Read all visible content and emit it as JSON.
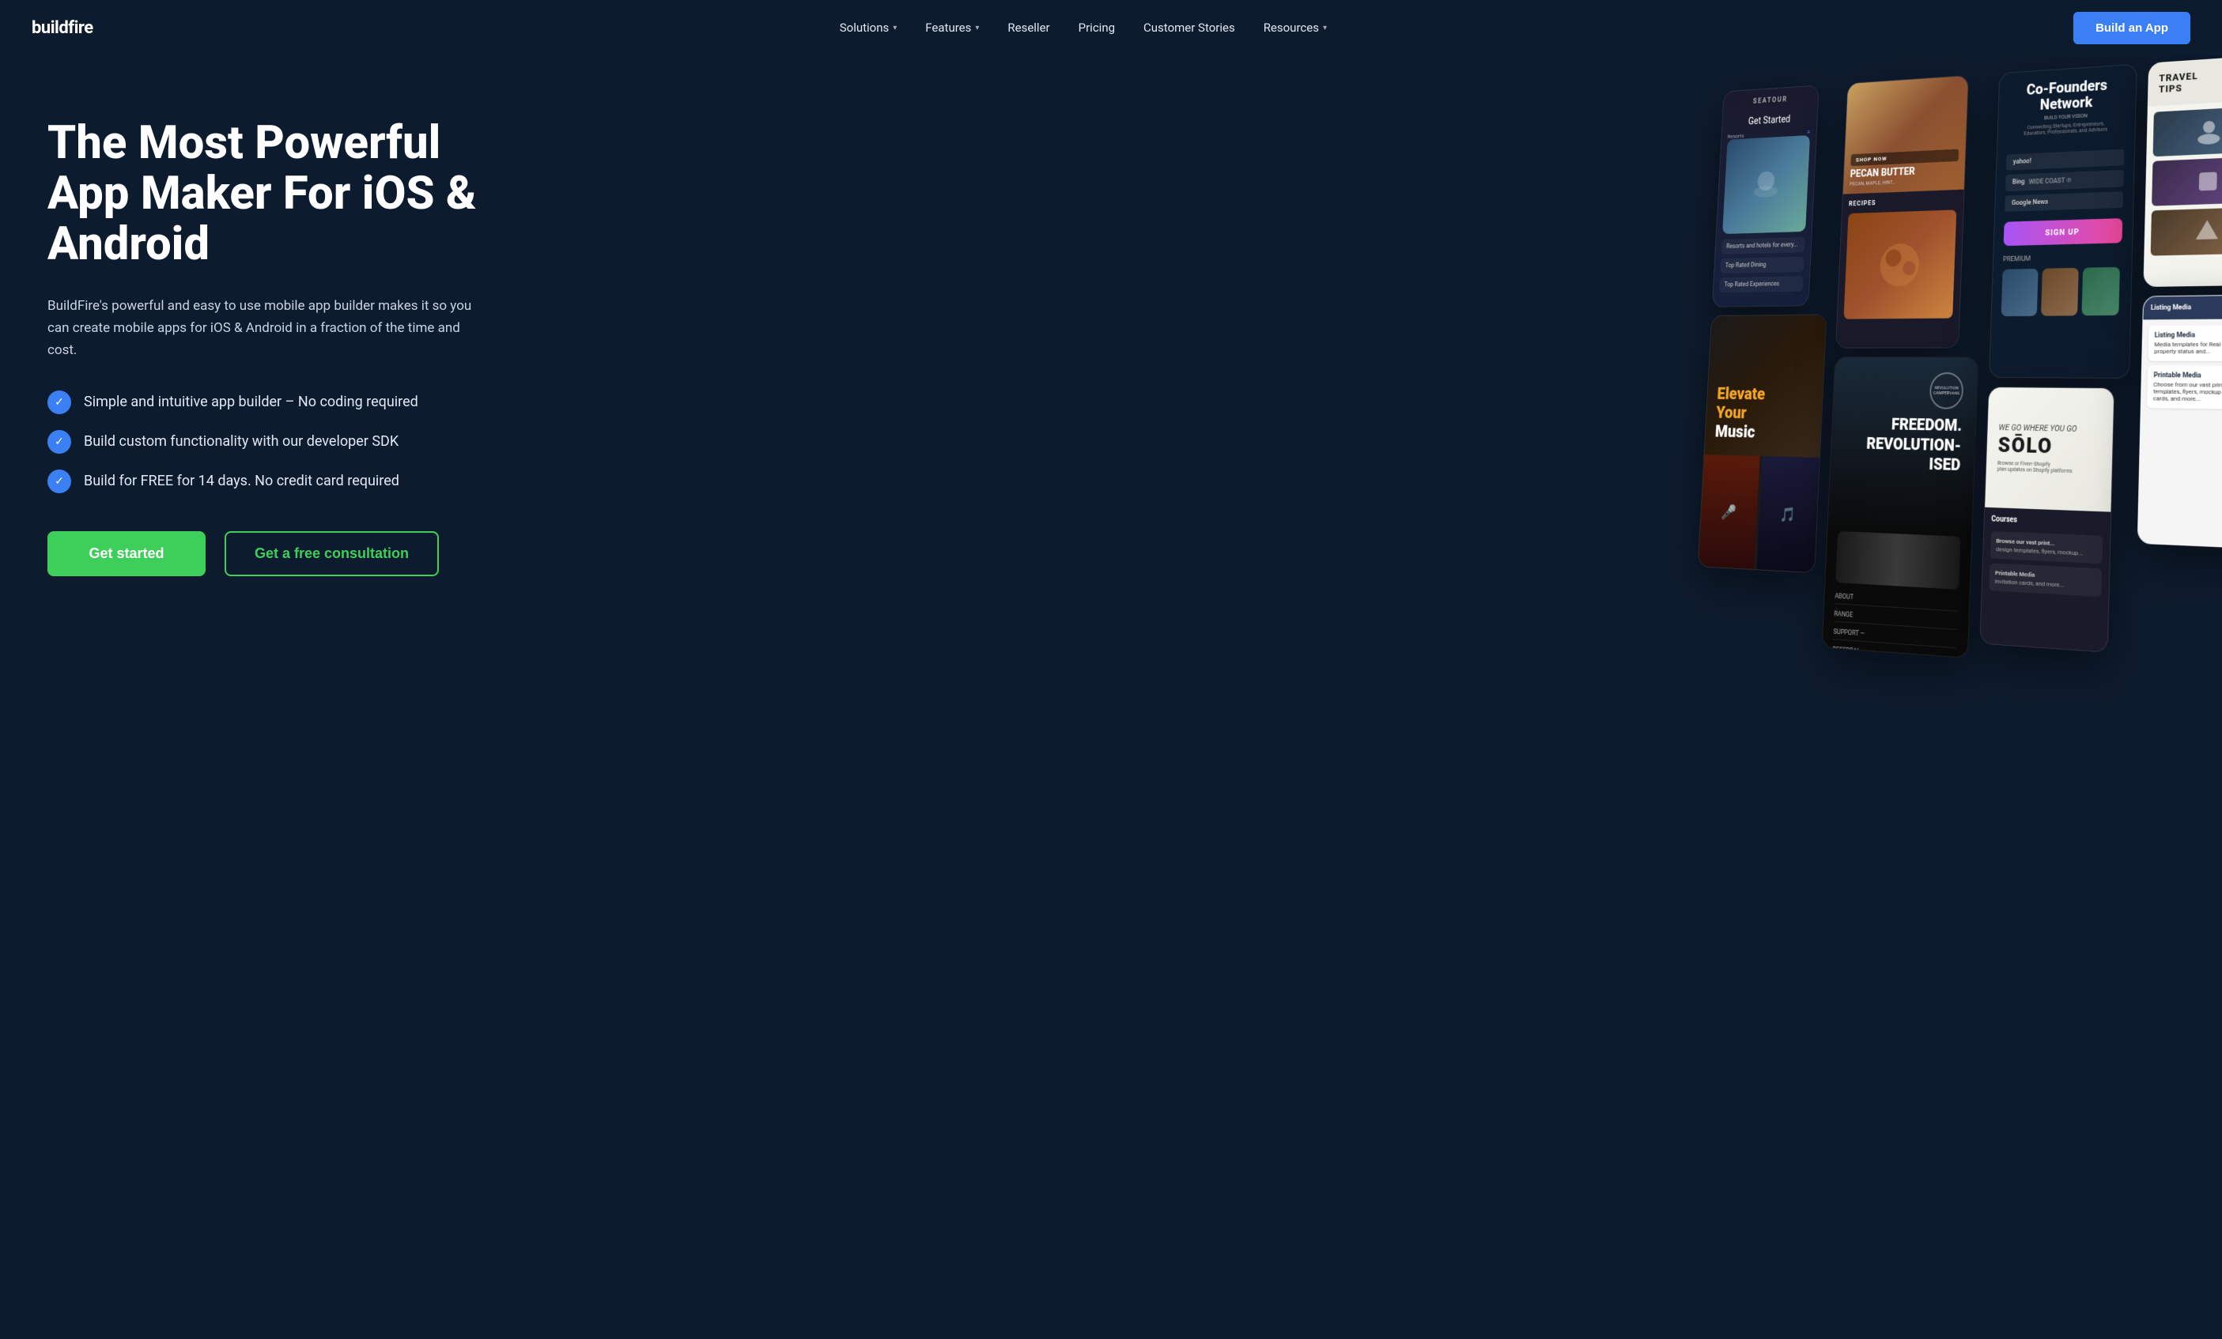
{
  "brand": {
    "name": "buildfire",
    "logo_text": "buildfire"
  },
  "navbar": {
    "links": [
      {
        "label": "Solutions",
        "hasDropdown": true
      },
      {
        "label": "Features",
        "hasDropdown": true
      },
      {
        "label": "Reseller",
        "hasDropdown": false
      },
      {
        "label": "Pricing",
        "hasDropdown": false
      },
      {
        "label": "Customer Stories",
        "hasDropdown": false
      },
      {
        "label": "Resources",
        "hasDropdown": true
      }
    ],
    "cta_label": "Build an App"
  },
  "hero": {
    "title": "The Most Powerful App Maker For iOS & Android",
    "subtitle": "BuildFire's powerful and easy to use mobile app builder makes it so you can create mobile apps for iOS & Android in a fraction of the time and cost.",
    "features": [
      "Simple and intuitive app builder – No coding required",
      "Build custom functionality with our developer SDK",
      "Build for FREE for 14 days. No credit card required"
    ],
    "cta_primary": "Get started",
    "cta_secondary": "Get a free consultation"
  },
  "phone_apps": {
    "seatour": {
      "name": "SEATOUR",
      "get_started": "Get Started",
      "menu": [
        "Resorts",
        "Top Rated Dining",
        "Top Rated Experiences"
      ]
    },
    "food": {
      "shop_now": "SHOP NOW",
      "product": "PECAN BUTTER",
      "recipes": "RECIPES"
    },
    "cofounders": {
      "title": "Co-Founders Network",
      "subtitle": "BUILD YOUR VISION",
      "desc": "Connecting Startups, Entrepreneurs, Educators, Professionals, and Advisors",
      "logos": [
        "yahoo!",
        "Bing",
        "Google News"
      ],
      "signup": "SIGN UP",
      "premium": "PREMIUM"
    },
    "music": {
      "elevate": "Elevate",
      "your": "Your",
      "music": "Music"
    },
    "campervan": {
      "badge": "REVOLUTION CAMPERVANS",
      "headline": "FREEDOM. REVOLUTIONISED",
      "menu": [
        "ABOUT",
        "RANGE",
        "SUPPORT",
        "REFERRAL"
      ]
    },
    "solo": {
      "go_text": "WE GO WHERE YOU GO",
      "brand": "SŌLO",
      "courses": "Courses"
    },
    "travel": {
      "title": "TRAVEL TIPS"
    },
    "listing": {
      "items": [
        "Listing Media",
        "Printable Media"
      ]
    }
  }
}
